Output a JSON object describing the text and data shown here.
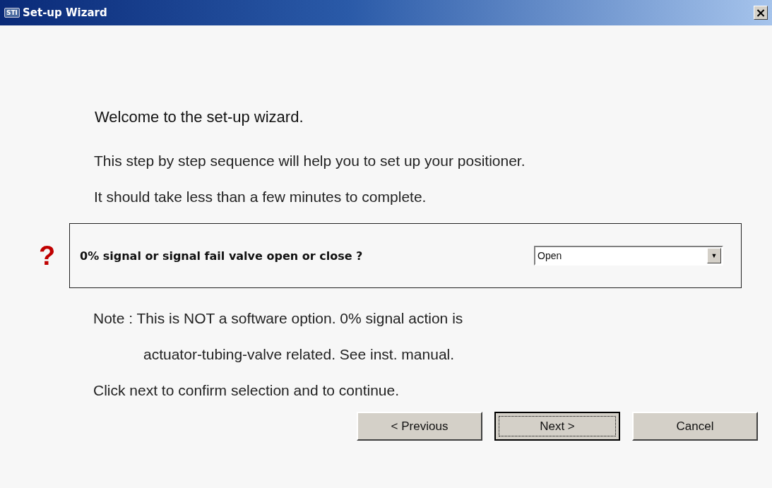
{
  "window": {
    "icon_text": "STI",
    "title": "Set-up Wizard",
    "close": "×"
  },
  "heading": "Welcome to the set-up wizard.",
  "intro": [
    "This step by step sequence will help you to set up your positioner.",
    "It should take less than a few minutes to complete."
  ],
  "question": {
    "mark": "?",
    "label": "0% signal or signal fail valve open or close ?",
    "dropdown": {
      "value": "Open",
      "arrow": "▼"
    }
  },
  "note": [
    "Note : This is NOT a software option. 0% signal action is",
    "actuator-tubing-valve related. See inst. manual."
  ],
  "instruction": "Click next to confirm selection and to continue.",
  "buttons": [
    {
      "label": "< Previous",
      "focused": false
    },
    {
      "label": "Next >",
      "focused": true
    },
    {
      "label": "Cancel",
      "focused": false
    }
  ]
}
